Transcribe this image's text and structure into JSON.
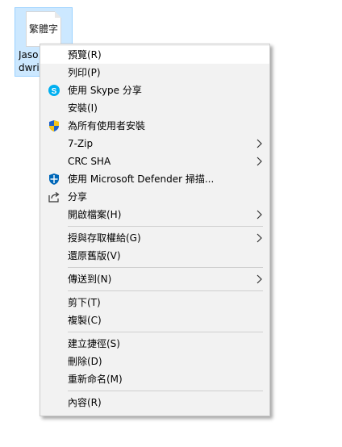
{
  "file": {
    "thumbnail_text": "繁體字",
    "name_line1": "Jaso",
    "name_line2": "dwrit"
  },
  "menu": {
    "groups": [
      [
        {
          "label": "預覽(R)",
          "icon": "",
          "submenu": false
        },
        {
          "label": "列印(P)",
          "icon": "",
          "submenu": false
        },
        {
          "label": "使用 Skype 分享",
          "icon": "skype-icon",
          "submenu": false
        },
        {
          "label": "安裝(I)",
          "icon": "",
          "submenu": false
        },
        {
          "label": "為所有使用者安裝",
          "icon": "uac-shield-icon",
          "submenu": false
        },
        {
          "label": "7-Zip",
          "icon": "",
          "submenu": true
        },
        {
          "label": "CRC SHA",
          "icon": "",
          "submenu": true
        },
        {
          "label": "使用 Microsoft Defender 掃描...",
          "icon": "defender-icon",
          "submenu": false
        },
        {
          "label": "分享",
          "icon": "share-icon",
          "submenu": false
        },
        {
          "label": "開啟檔案(H)",
          "icon": "",
          "submenu": true
        }
      ],
      [
        {
          "label": "授與存取權給(G)",
          "icon": "",
          "submenu": true
        },
        {
          "label": "還原舊版(V)",
          "icon": "",
          "submenu": false
        }
      ],
      [
        {
          "label": "傳送到(N)",
          "icon": "",
          "submenu": true
        }
      ],
      [
        {
          "label": "剪下(T)",
          "icon": "",
          "submenu": false
        },
        {
          "label": "複製(C)",
          "icon": "",
          "submenu": false
        }
      ],
      [
        {
          "label": "建立捷徑(S)",
          "icon": "",
          "submenu": false
        },
        {
          "label": "刪除(D)",
          "icon": "",
          "submenu": false
        },
        {
          "label": "重新命名(M)",
          "icon": "",
          "submenu": false
        }
      ],
      [
        {
          "label": "內容(R)",
          "icon": "",
          "submenu": false
        }
      ]
    ]
  },
  "colors": {
    "menu_background": "#f2f2f2",
    "hover_background": "#ffffff",
    "selection_background": "#cce8ff",
    "skype_blue": "#00aff0",
    "defender_blue": "#0067b8"
  }
}
